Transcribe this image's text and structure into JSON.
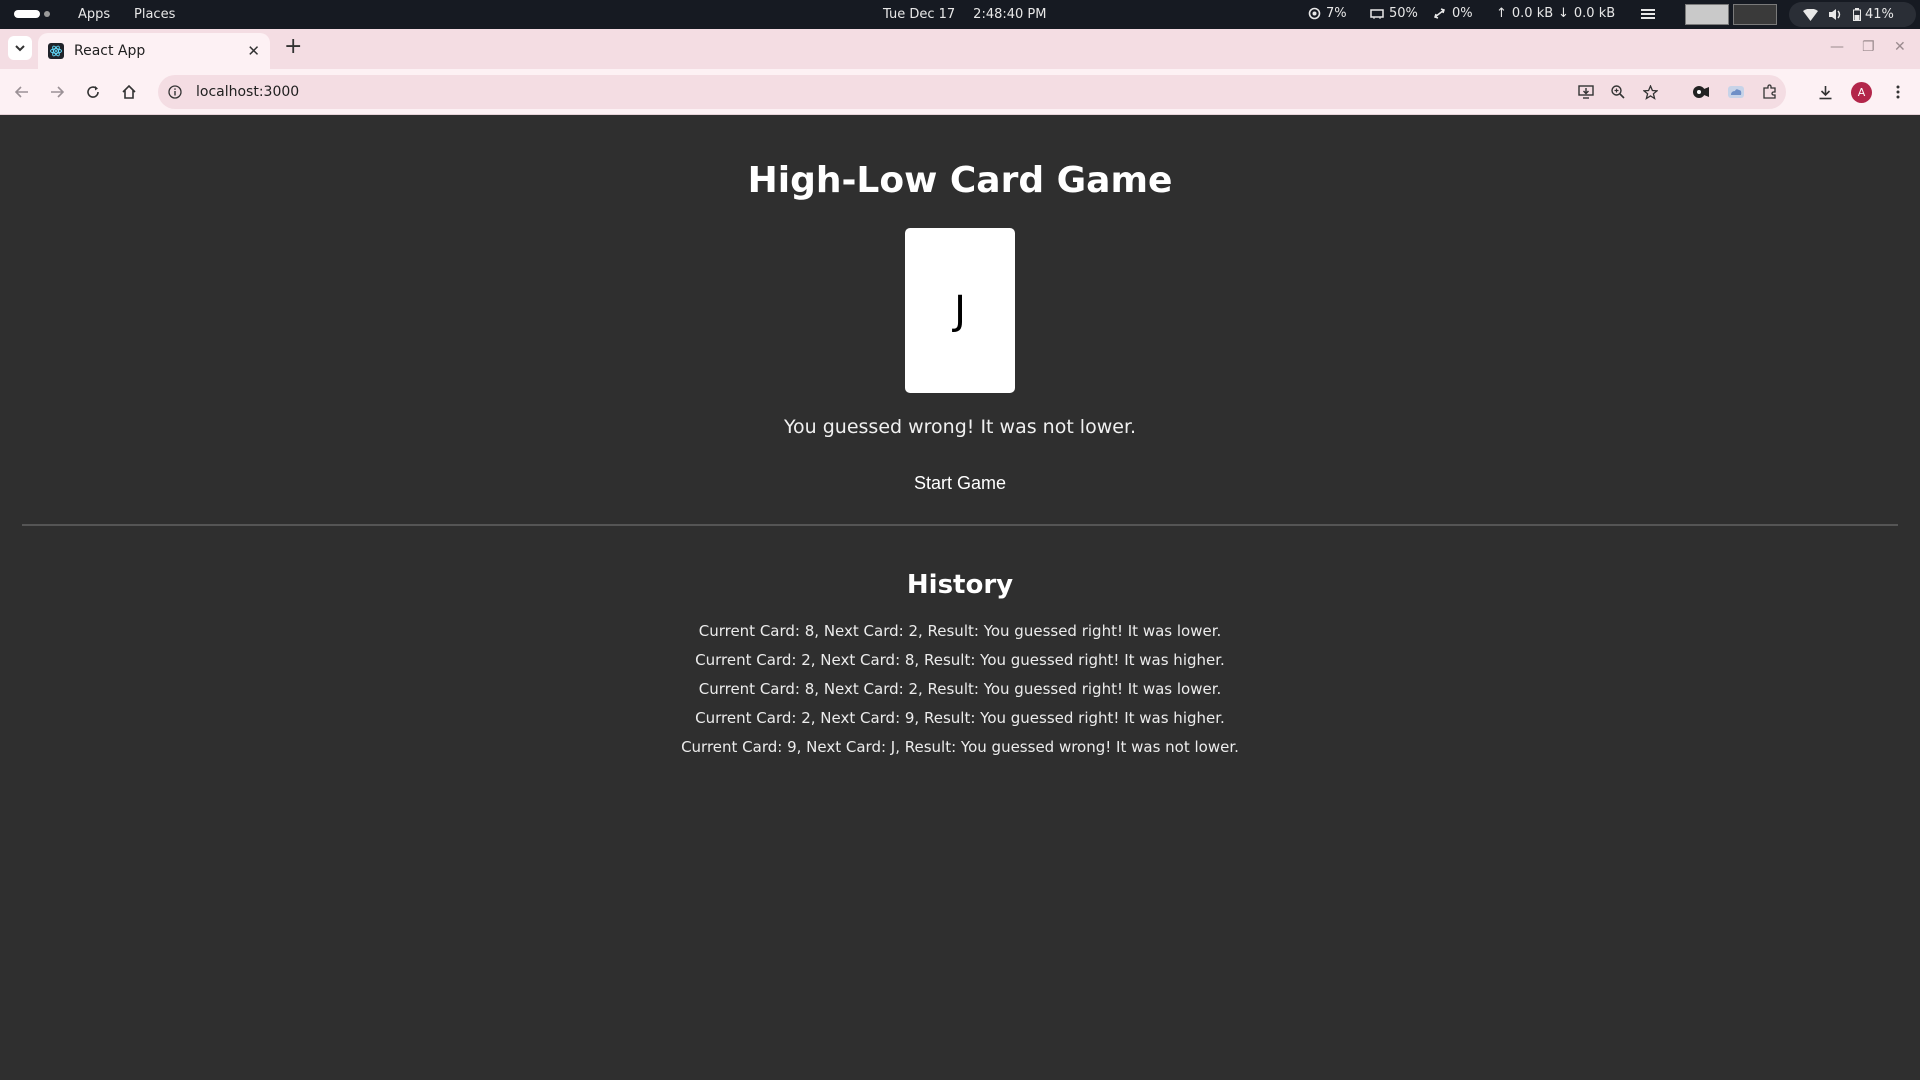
{
  "system_bar": {
    "apps_label": "Apps",
    "places_label": "Places",
    "date": "Tue Dec 17",
    "time": "2:48:40 PM",
    "cpu": "7%",
    "memory": "50%",
    "swap": "0%",
    "upload": "0.0 kB",
    "download": "0.0 kB",
    "battery": "41%"
  },
  "browser": {
    "tab_title": "React App",
    "url": "localhost:3000",
    "avatar_letter": "A"
  },
  "game": {
    "title": "High-Low Card Game",
    "card_value": "J",
    "message": "You guessed wrong! It was not lower.",
    "start_button": "Start Game"
  },
  "history": {
    "title": "History",
    "entries": [
      "Current Card: 8, Next Card: 2, Result: You guessed right! It was lower.",
      "Current Card: 2, Next Card: 8, Result: You guessed right! It was higher.",
      "Current Card: 8, Next Card: 2, Result: You guessed right! It was lower.",
      "Current Card: 2, Next Card: 9, Result: You guessed right! It was higher.",
      "Current Card: 9, Next Card: J, Result: You guessed wrong! It was not lower."
    ]
  }
}
